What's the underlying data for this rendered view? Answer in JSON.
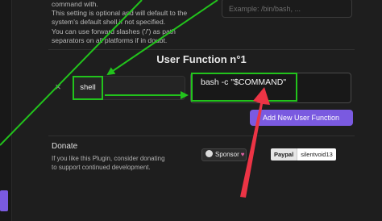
{
  "settings": {
    "description_lines": [
      "command with.",
      "This setting is optional and will default to the",
      "system's default shell if not specified.",
      "You can use forward slashes ('/') as path",
      "separators on all platforms if in doubt."
    ],
    "shell_path_placeholder": "Example: /bin/bash, ..."
  },
  "user_function": {
    "title": "User Function n°1",
    "remove_icon": "×",
    "name_value": "shell",
    "command_value": "bash -c \"$COMMAND\""
  },
  "add_button_label": "Add New User Function",
  "donate": {
    "title": "Donate",
    "text_lines": [
      "If you like this Plugin, consider donating",
      "to support continued development."
    ],
    "sponsor_label": "Sponsor",
    "paypal_label": "Paypal",
    "paypal_user": "silentvoid13"
  },
  "annotation_colors": {
    "highlight": "#22c31c",
    "arrow": "#ec3445"
  }
}
